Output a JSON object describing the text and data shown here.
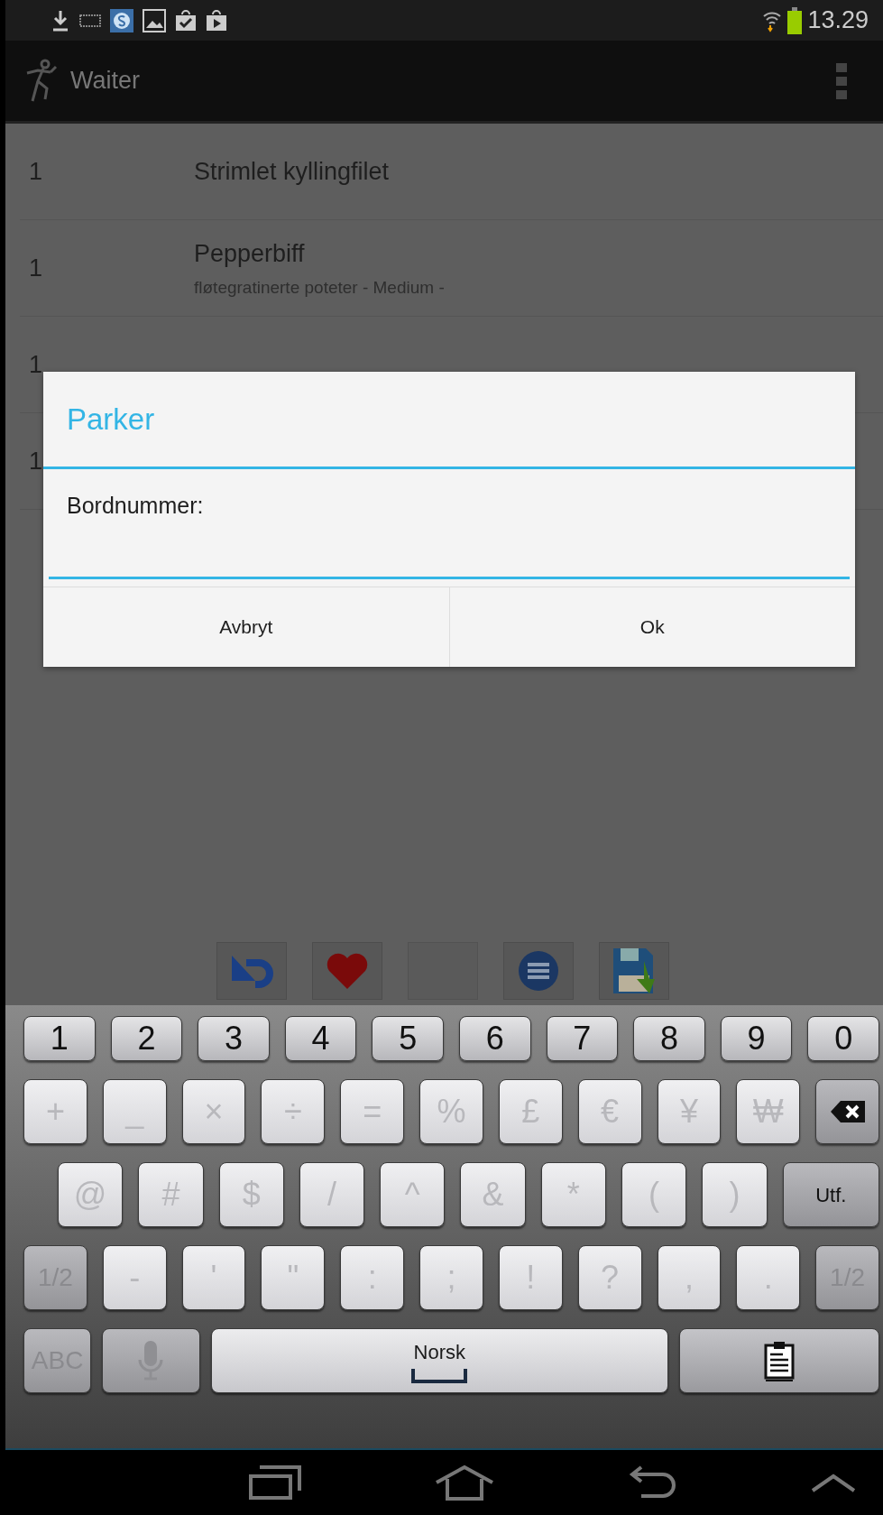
{
  "status_bar": {
    "time": "13.29"
  },
  "action_bar": {
    "title": "Waiter"
  },
  "order_items": [
    {
      "quantity": "1",
      "name": "Strimlet kyllingfilet"
    },
    {
      "quantity": "1",
      "name": "Pepperbiff",
      "details": "fløtegratinerte poteter - Medium -"
    },
    {
      "quantity": "1"
    },
    {
      "quantity": "1"
    }
  ],
  "dialog": {
    "title": "Parker",
    "label": "Bordnummer:",
    "buttons": [
      "Avbryt",
      "Ok"
    ]
  },
  "keyboard": {
    "rows": [
      [
        {
          "kind": "number",
          "label": "1"
        },
        {
          "kind": "number",
          "label": "2"
        },
        {
          "kind": "number",
          "label": "3"
        },
        {
          "kind": "number",
          "label": "4"
        },
        {
          "kind": "number",
          "label": "5"
        },
        {
          "kind": "number",
          "label": "6"
        },
        {
          "kind": "number",
          "label": "7"
        },
        {
          "kind": "number",
          "label": "8"
        },
        {
          "kind": "number",
          "label": "9"
        },
        {
          "kind": "number",
          "label": "0"
        }
      ],
      [
        {
          "kind": "symbol",
          "label": "+"
        },
        {
          "kind": "symbol",
          "label": "_"
        },
        {
          "kind": "symbol",
          "label": "×"
        },
        {
          "kind": "symbol",
          "label": "÷"
        },
        {
          "kind": "symbol",
          "label": "="
        },
        {
          "kind": "symbol",
          "label": "%"
        },
        {
          "kind": "symbol",
          "label": "£"
        },
        {
          "kind": "symbol",
          "label": "€"
        },
        {
          "kind": "symbol",
          "label": "¥"
        },
        {
          "kind": "symbol",
          "label": "₩"
        },
        {
          "kind": "backspace"
        }
      ],
      [
        {
          "kind": "symbol",
          "label": "@"
        },
        {
          "kind": "symbol",
          "label": "#"
        },
        {
          "kind": "symbol",
          "label": "$"
        },
        {
          "kind": "symbol",
          "label": "/"
        },
        {
          "kind": "symbol",
          "label": "^"
        },
        {
          "kind": "symbol",
          "label": "&"
        },
        {
          "kind": "symbol",
          "label": "*"
        },
        {
          "kind": "symbol",
          "label": "("
        },
        {
          "kind": "symbol",
          "label": ")"
        },
        {
          "kind": "action",
          "label": "Utf."
        }
      ],
      [
        {
          "kind": "shift",
          "label": "1/2"
        },
        {
          "kind": "symbol",
          "label": "-"
        },
        {
          "kind": "symbol",
          "label": "'"
        },
        {
          "kind": "symbol",
          "label": "\""
        },
        {
          "kind": "symbol",
          "label": ":"
        },
        {
          "kind": "symbol",
          "label": ";"
        },
        {
          "kind": "symbol",
          "label": "!"
        },
        {
          "kind": "symbol",
          "label": "?"
        },
        {
          "kind": "symbol",
          "label": ","
        },
        {
          "kind": "symbol",
          "label": "."
        },
        {
          "kind": "shift",
          "label": "1/2"
        }
      ],
      [
        {
          "kind": "shift",
          "label": "ABC"
        },
        {
          "kind": "mic"
        },
        {
          "kind": "space",
          "label": "Norsk"
        },
        {
          "kind": "clipboard"
        }
      ]
    ]
  }
}
